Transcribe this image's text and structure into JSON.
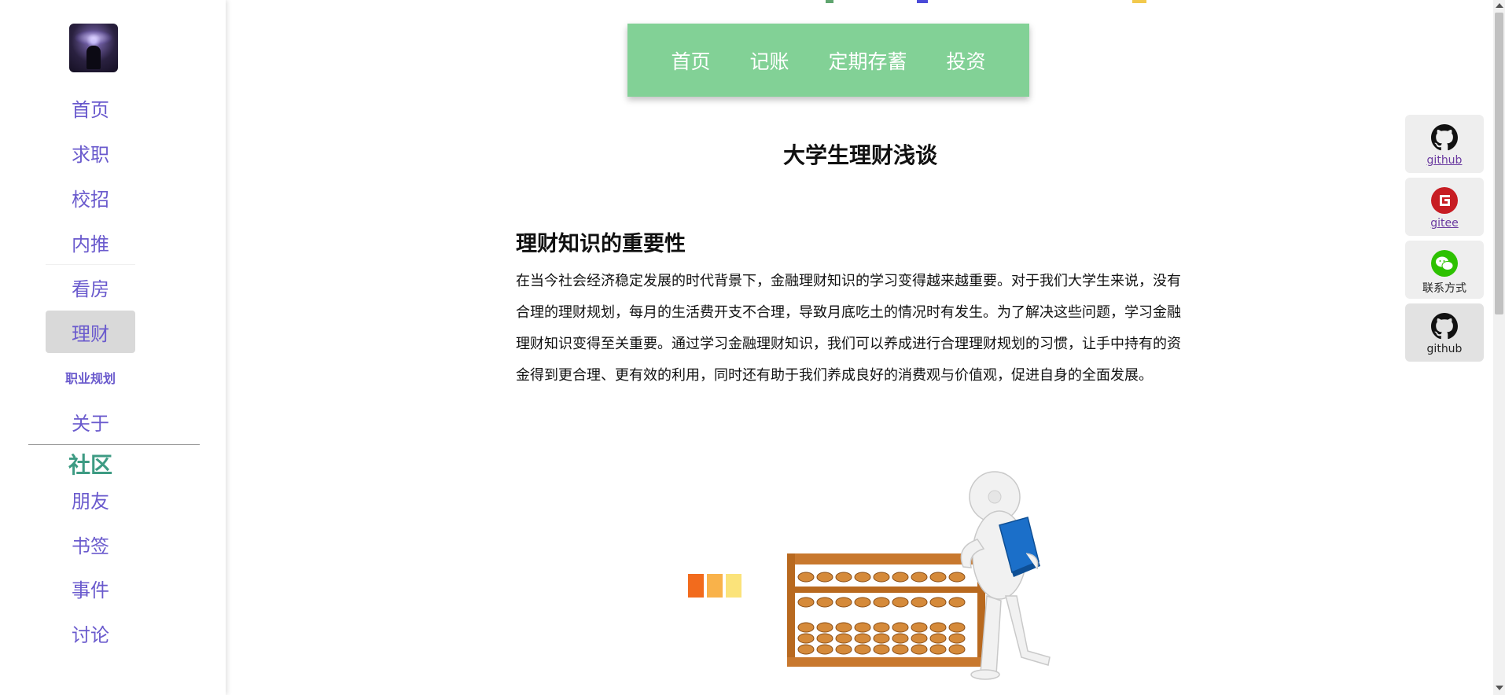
{
  "sidebar": {
    "nav": [
      {
        "label": "首页"
      },
      {
        "label": "求职"
      },
      {
        "label": "校招"
      },
      {
        "label": "内推"
      },
      {
        "label": "看房"
      },
      {
        "label": "理财",
        "active": true
      },
      {
        "label": "职业规划"
      },
      {
        "label": "关于"
      }
    ],
    "community_title": "社区",
    "community": [
      {
        "label": "朋友"
      },
      {
        "label": "书签"
      },
      {
        "label": "事件"
      },
      {
        "label": "讨论"
      }
    ]
  },
  "topnav": {
    "items": [
      "首页",
      "记账",
      "定期存蓄",
      "投资"
    ]
  },
  "article": {
    "title": "大学生理财浅谈",
    "section_heading": "理财知识的重要性",
    "paragraph": "在当今社会经济稳定发展的时代背景下，金融理财知识的学习变得越来越重要。对于我们大学生来说，没有合理的理财规划，每月的生活费开支不合理，导致月底吃土的情况时有发生。为了解决这些问题，学习金融理财知识变得至关重要。通过学习金融理财知识，我们可以养成进行合理理财规划的习惯，让手中持有的资金得到更合理、更有效的利用，同时还有助于我们养成良好的消费观与价值观，促进自身的全面发展。"
  },
  "social": [
    {
      "label": "github",
      "icon": "github-icon",
      "link": true
    },
    {
      "label": "gitee",
      "icon": "gitee-icon",
      "link": true
    },
    {
      "label": "联系方式",
      "icon": "wechat-icon",
      "link": false
    },
    {
      "label": "github",
      "icon": "github-icon",
      "link": false
    }
  ],
  "colors": {
    "nav_text": "#6a5acd",
    "community_title": "#3d9b83",
    "topnav_bg": "#82d196",
    "gitee_red": "#c71d23",
    "wechat_green": "#2dc100"
  }
}
